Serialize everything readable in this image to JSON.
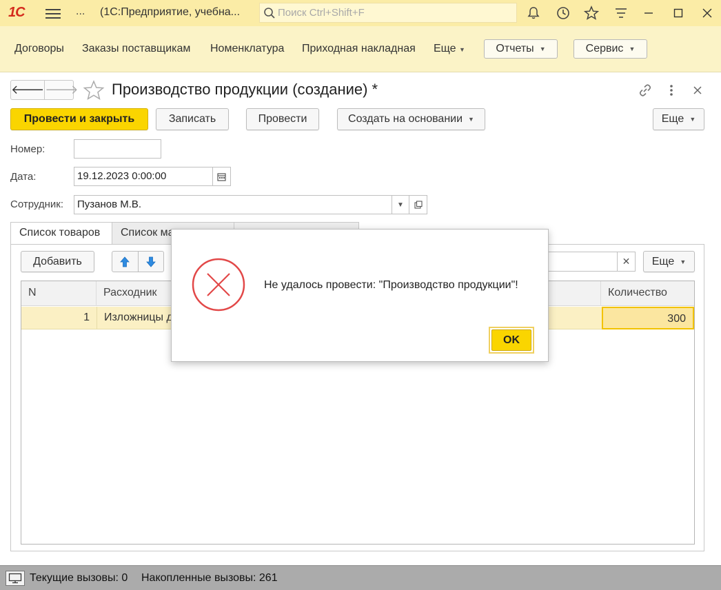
{
  "window": {
    "logo": "1С",
    "title": "(1С:Предприятие, учебна...",
    "menu_dots": "...",
    "search_placeholder": "Поиск Ctrl+Shift+F"
  },
  "sections": {
    "links": [
      "Договоры",
      "Заказы поставщикам",
      "Номенклатура",
      "Приходная накладная"
    ],
    "more": "Еще",
    "reports": "Отчеты",
    "service": "Сервис"
  },
  "form": {
    "title": "Производство продукции (создание) *",
    "buttons": {
      "post_close": "Провести и закрыть",
      "write": "Записать",
      "post": "Провести",
      "create_based": "Создать на основании",
      "more": "Еще"
    },
    "fields": {
      "number_label": "Номер:",
      "number_value": "",
      "date_label": "Дата:",
      "date_value": "19.12.2023  0:00:00",
      "employee_label": "Сотрудник:",
      "employee_value": "Пузанов М.В."
    },
    "tabs": [
      "Список товаров",
      "Список ма"
    ],
    "table_toolbar": {
      "add": "Добавить",
      "more": "Еще"
    },
    "table": {
      "columns": [
        "N",
        "Расходник",
        "Количество"
      ],
      "rows": [
        {
          "n": "1",
          "item": "Изложницы д",
          "qty": "300"
        }
      ]
    }
  },
  "dialog": {
    "message": "Не удалось провести: \"Производство продукции\"!",
    "ok": "OK"
  },
  "status": {
    "current_calls": "Текущие вызовы: 0",
    "accumulated_calls": "Накопленные вызовы: 261"
  }
}
